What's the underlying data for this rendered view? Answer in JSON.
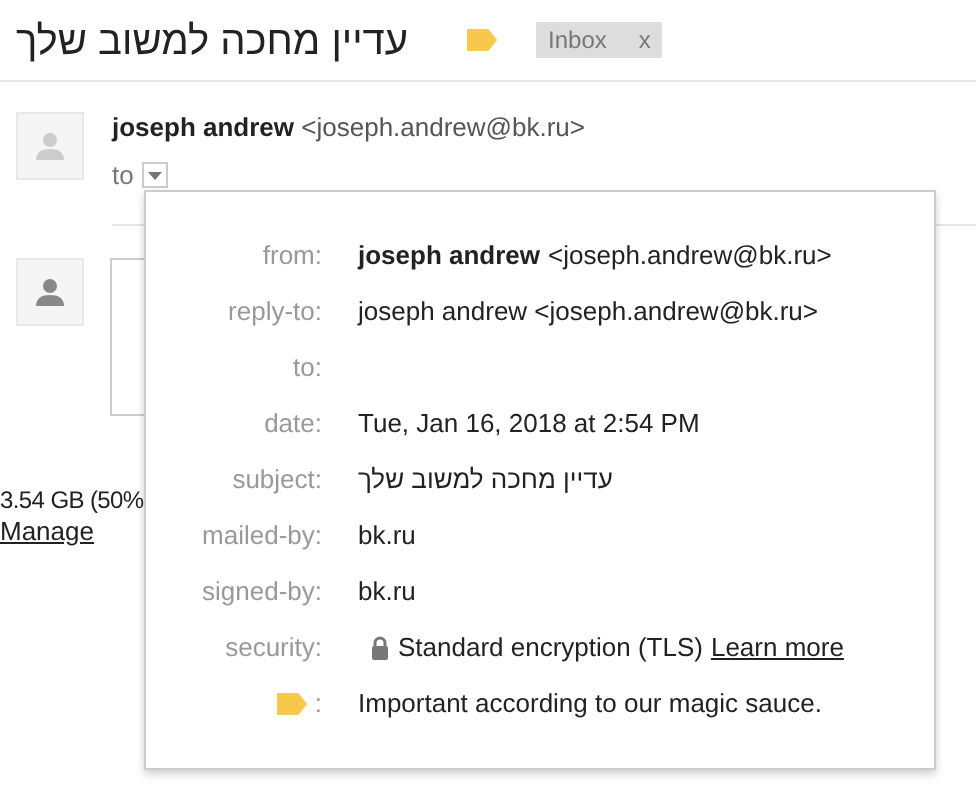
{
  "subject": "עדיין מחכה למשוב שלך",
  "label_chip": {
    "text": "Inbox",
    "close": "x"
  },
  "message": {
    "sender_name": "joseph andrew",
    "sender_email": "<joseph.andrew@bk.ru>",
    "to": "to"
  },
  "details": [
    {
      "kind": "text",
      "label": "from:",
      "bold": "joseph andrew",
      "value": "<joseph.andrew@bk.ru>"
    },
    {
      "kind": "text",
      "label": "reply-to:",
      "value": "joseph andrew <joseph.andrew@bk.ru>"
    },
    {
      "kind": "text",
      "label": "to:"
    },
    {
      "kind": "text",
      "label": "date:",
      "value": "Tue, Jan 16, 2018 at 2:54 PM"
    },
    {
      "kind": "text",
      "label": "subject:",
      "value": "עדיין מחכה למשוב שלך"
    },
    {
      "kind": "text",
      "label": "mailed-by:",
      "value": "bk.ru"
    },
    {
      "kind": "text",
      "label": "signed-by:",
      "value": "bk.ru"
    },
    {
      "kind": "security",
      "label": "security:",
      "value": "Standard encryption (TLS)",
      "link": "Learn more"
    },
    {
      "kind": "importance",
      "label": ":",
      "value": "Important according to our magic sauce."
    }
  ],
  "storage": {
    "usage": "3.54 GB (50%",
    "link": "Manage"
  }
}
